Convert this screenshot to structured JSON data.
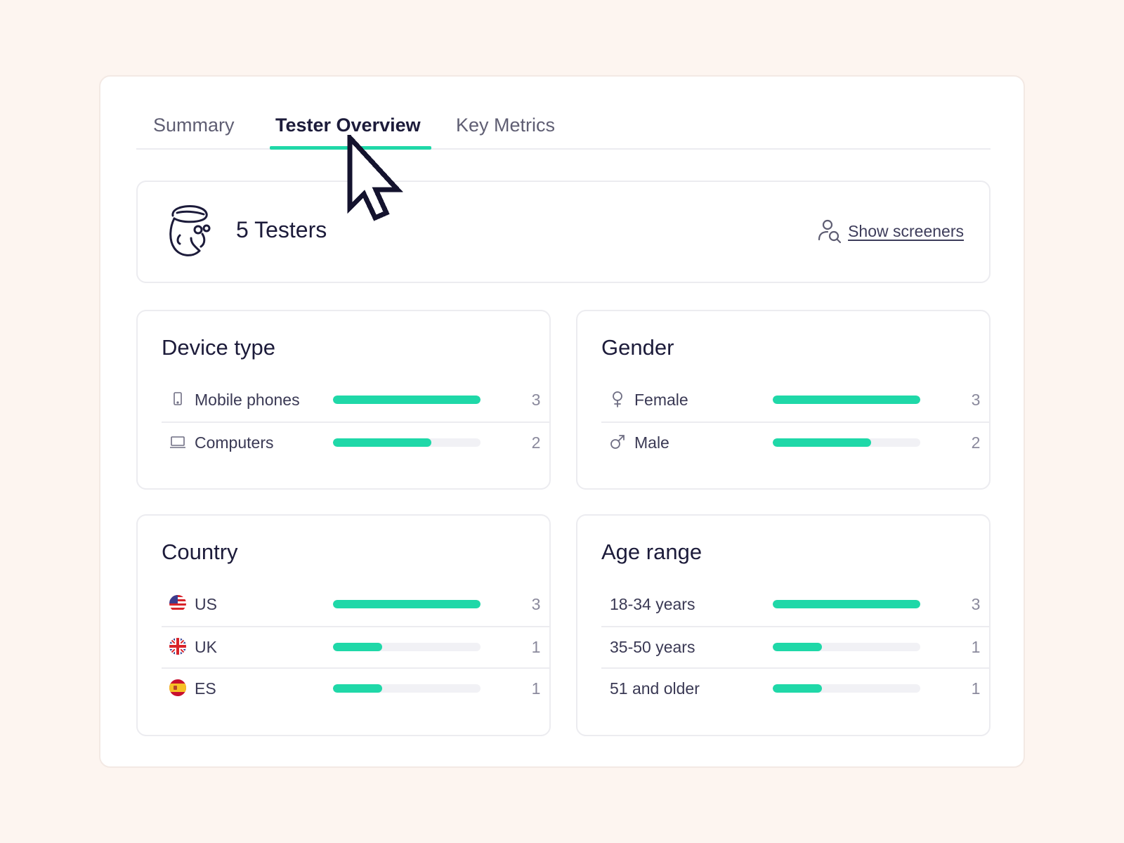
{
  "tabs": [
    {
      "label": "Summary",
      "active": false
    },
    {
      "label": "Tester Overview",
      "active": true
    },
    {
      "label": "Key Metrics",
      "active": false
    }
  ],
  "testers": {
    "count_label": "5 Testers",
    "icon": "tester-face-icon",
    "screeners_label": "Show screeners",
    "screeners_icon": "user-search-icon"
  },
  "accent_color": "#1fd8a8",
  "device": {
    "title": "Device type",
    "rows": [
      {
        "label": "Mobile phones",
        "count": "3",
        "fraction": 1.0,
        "icon": "mobile-phone-icon"
      },
      {
        "label": "Computers",
        "count": "2",
        "fraction": 0.667,
        "icon": "laptop-icon"
      }
    ]
  },
  "gender": {
    "title": "Gender",
    "rows": [
      {
        "label": "Female",
        "count": "3",
        "fraction": 1.0,
        "icon": "female-symbol-icon"
      },
      {
        "label": "Male",
        "count": "2",
        "fraction": 0.667,
        "icon": "male-symbol-icon"
      }
    ]
  },
  "country": {
    "title": "Country",
    "rows": [
      {
        "label": "US",
        "count": "3",
        "fraction": 1.0,
        "icon": "us-flag-icon"
      },
      {
        "label": "UK",
        "count": "1",
        "fraction": 0.333,
        "icon": "uk-flag-icon"
      },
      {
        "label": "ES",
        "count": "1",
        "fraction": 0.333,
        "icon": "es-flag-icon"
      }
    ]
  },
  "age": {
    "title": "Age range",
    "rows": [
      {
        "label": "18-34 years",
        "count": "3",
        "fraction": 1.0
      },
      {
        "label": "35-50 years",
        "count": "1",
        "fraction": 0.333
      },
      {
        "label": "51 and older",
        "count": "1",
        "fraction": 0.333
      }
    ]
  }
}
